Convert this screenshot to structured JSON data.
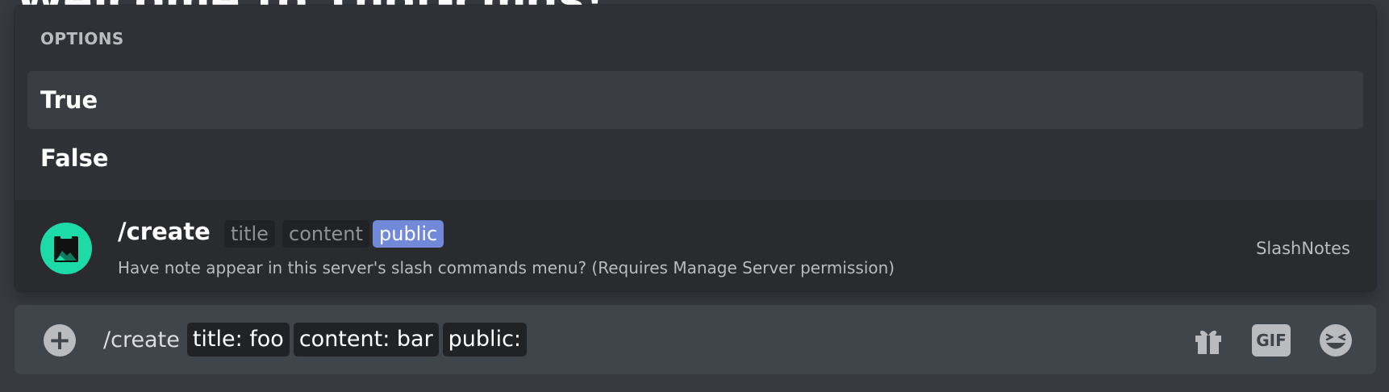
{
  "background": {
    "heading": "Welcome to Thot-cmds!"
  },
  "autocomplete": {
    "section_label": "OPTIONS",
    "options": [
      {
        "label": "True",
        "selected": true
      },
      {
        "label": "False",
        "selected": false
      }
    ],
    "command": {
      "name": "/create",
      "params": [
        "title",
        "content",
        "public"
      ],
      "active_param": "public",
      "description": "Have note appear in this server's slash commands menu? (Requires Manage Server permission)",
      "app_name": "SlashNotes",
      "avatar_color": "#1cdba7"
    }
  },
  "composer": {
    "typed_command": "/create",
    "chips": [
      "title: foo",
      "content: bar",
      "public:"
    ],
    "gif_label": "GIF",
    "icons": [
      "add-circle-icon",
      "gift-icon",
      "gif-icon",
      "emoji-icon"
    ]
  },
  "colors": {
    "accent": "#7289da",
    "popup_bg": "#2f3136",
    "composer_bg": "#40444b"
  }
}
